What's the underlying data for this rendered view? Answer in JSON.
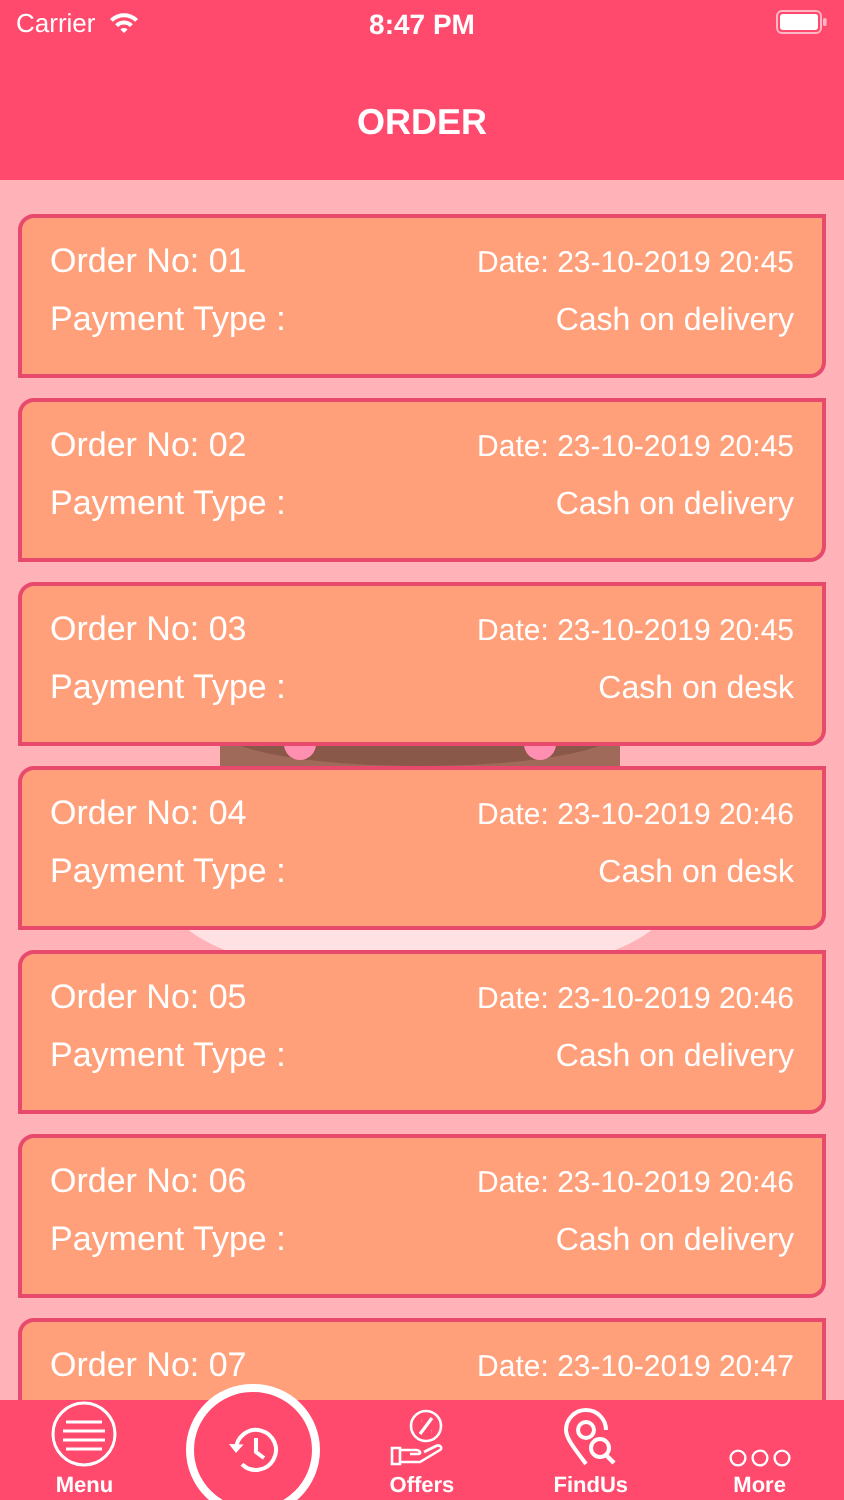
{
  "status_bar": {
    "carrier": "Carrier",
    "time": "8:47 PM"
  },
  "header": {
    "title": "ORDER"
  },
  "orders": [
    {
      "order_no": "Order No: 01",
      "date": "Date: 23-10-2019 20:45",
      "payment_label": "Payment Type :",
      "payment": "Cash on delivery"
    },
    {
      "order_no": "Order No: 02",
      "date": "Date: 23-10-2019 20:45",
      "payment_label": "Payment Type :",
      "payment": "Cash on delivery"
    },
    {
      "order_no": "Order No: 03",
      "date": "Date: 23-10-2019 20:45",
      "payment_label": "Payment Type :",
      "payment": "Cash on desk"
    },
    {
      "order_no": "Order No: 04",
      "date": "Date: 23-10-2019 20:46",
      "payment_label": "Payment Type :",
      "payment": "Cash on desk"
    },
    {
      "order_no": "Order No: 05",
      "date": "Date: 23-10-2019 20:46",
      "payment_label": "Payment Type :",
      "payment": "Cash on delivery"
    },
    {
      "order_no": "Order No: 06",
      "date": "Date: 23-10-2019 20:46",
      "payment_label": "Payment Type :",
      "payment": "Cash on delivery"
    },
    {
      "order_no": "Order No: 07",
      "date": "Date: 23-10-2019 20:47"
    }
  ],
  "tab_bar": [
    {
      "kind": "menu",
      "label": "Menu",
      "selected": false
    },
    {
      "kind": "history",
      "selected": true
    },
    {
      "kind": "offers",
      "label": "Offers",
      "selected": false
    },
    {
      "kind": "findus",
      "label": "FindUs",
      "selected": false
    },
    {
      "kind": "more",
      "label": "More",
      "selected": false
    }
  ]
}
